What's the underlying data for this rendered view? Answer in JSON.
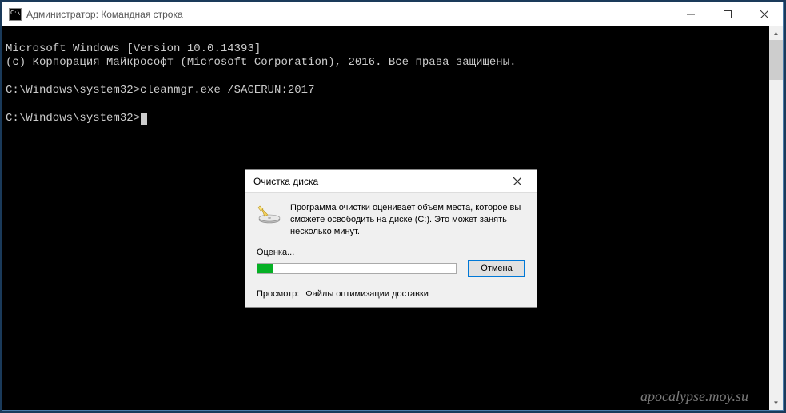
{
  "window": {
    "title": "Администратор: Командная строка"
  },
  "console": {
    "line1": "Microsoft Windows [Version 10.0.14393]",
    "line2": "(c) Корпорация Майкрософт (Microsoft Corporation), 2016. Все права защищены.",
    "blank": "",
    "prompt1_path": "C:\\Windows\\system32>",
    "prompt1_cmd": "cleanmgr.exe /SAGERUN:2017",
    "prompt2_path": "C:\\Windows\\system32>"
  },
  "dialog": {
    "title": "Очистка диска",
    "message": "Программа очистки оценивает объем места, которое вы сможете освободить на диске  (C:). Это может занять несколько минут.",
    "eval_label": "Оценка...",
    "cancel_label": "Отмена",
    "view_label": "Просмотр:",
    "view_value": "Файлы оптимизации доставки",
    "progress_percent": 8
  },
  "watermark": "apocalypse.moy.su"
}
